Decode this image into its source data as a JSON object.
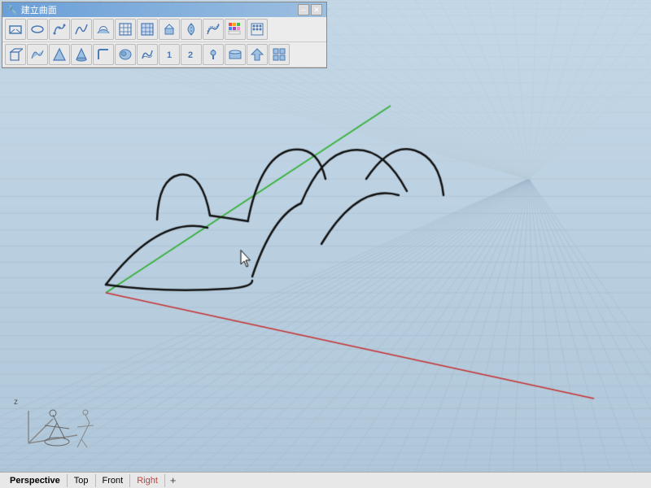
{
  "toolbar": {
    "title": "建立曲面",
    "close_btn": "✕",
    "min_btn": "─",
    "rows": [
      [
        "□",
        "○",
        "✦",
        "⟳",
        "⌒",
        "▦",
        "▦",
        "◻",
        "◈",
        "◆",
        "▨",
        "⋯"
      ],
      [
        "□",
        "⌂",
        "▲",
        "△",
        "⌒",
        "○",
        "↺",
        "↺",
        "◉",
        "▣",
        "≡",
        "▦"
      ]
    ]
  },
  "viewport": {
    "label": "Perspective view - 3D grid"
  },
  "statusbar": {
    "tabs": [
      {
        "label": "Perspective",
        "active": true,
        "color": "black"
      },
      {
        "label": "Top",
        "active": false,
        "color": "black"
      },
      {
        "label": "Front",
        "active": false,
        "color": "black"
      },
      {
        "label": "Right",
        "active": false,
        "color": "red"
      }
    ],
    "plus": "+"
  },
  "colors": {
    "grid_bg": "#b8ccd8",
    "grid_line": "#a0b8c8",
    "axis_green": "#40b040",
    "axis_red": "#c83030",
    "curve_color": "#111111"
  }
}
